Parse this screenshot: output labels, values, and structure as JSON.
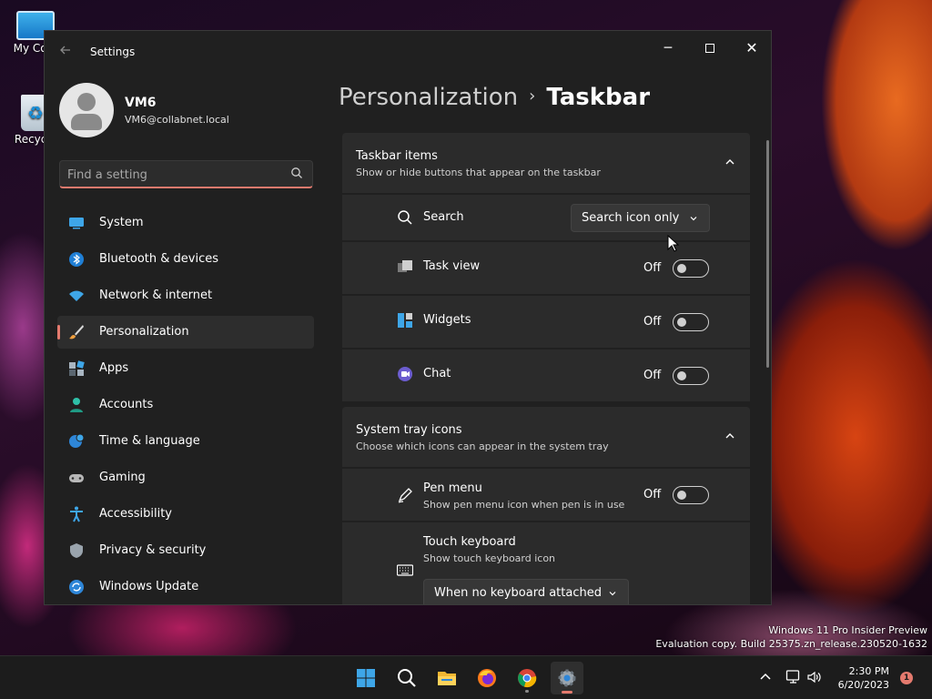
{
  "desktop": {
    "icons": [
      {
        "label": "My Com"
      },
      {
        "label": "Recycle"
      }
    ],
    "watermark": {
      "line1": "Windows 11 Pro Insider Preview",
      "line2": "Evaluation copy. Build 25375.zn_release.230520-1632"
    }
  },
  "window": {
    "title": "Settings",
    "controls": {
      "minimize": "─",
      "close": "✕"
    }
  },
  "profile": {
    "name": "VM6",
    "email": "VM6@collabnet.local"
  },
  "search": {
    "placeholder": "Find a setting"
  },
  "sidebar": {
    "items": [
      {
        "label": "System",
        "icon": "system-icon",
        "active": false
      },
      {
        "label": "Bluetooth & devices",
        "icon": "bluetooth-icon",
        "active": false
      },
      {
        "label": "Network & internet",
        "icon": "wifi-icon",
        "active": false
      },
      {
        "label": "Personalization",
        "icon": "brush-icon",
        "active": true
      },
      {
        "label": "Apps",
        "icon": "apps-icon",
        "active": false
      },
      {
        "label": "Accounts",
        "icon": "accounts-icon",
        "active": false
      },
      {
        "label": "Time & language",
        "icon": "globe-clock-icon",
        "active": false
      },
      {
        "label": "Gaming",
        "icon": "gamepad-icon",
        "active": false
      },
      {
        "label": "Accessibility",
        "icon": "accessibility-icon",
        "active": false
      },
      {
        "label": "Privacy & security",
        "icon": "shield-icon",
        "active": false
      },
      {
        "label": "Windows Update",
        "icon": "update-icon",
        "active": false
      }
    ]
  },
  "breadcrumb": {
    "parent": "Personalization",
    "separator": "›",
    "current": "Taskbar"
  },
  "taskbar_items": {
    "title": "Taskbar items",
    "subtitle": "Show or hide buttons that appear on the taskbar",
    "search": {
      "label": "Search",
      "value": "Search icon only"
    },
    "task_view": {
      "label": "Task view",
      "state": "Off"
    },
    "widgets": {
      "label": "Widgets",
      "state": "Off"
    },
    "chat": {
      "label": "Chat",
      "state": "Off"
    }
  },
  "system_tray": {
    "title": "System tray icons",
    "subtitle": "Choose which icons can appear in the system tray",
    "pen_menu": {
      "label": "Pen menu",
      "sublabel": "Show pen menu icon when pen is in use",
      "state": "Off"
    },
    "touch_keyboard": {
      "label": "Touch keyboard",
      "sublabel": "Show touch keyboard icon",
      "value": "When no keyboard attached"
    }
  },
  "taskbar": {
    "apps": [
      "start-icon",
      "search-icon",
      "file-explorer-icon",
      "firefox-icon",
      "chrome-icon",
      "settings-icon"
    ],
    "clock": {
      "time": "2:30 PM",
      "date": "6/20/2023"
    },
    "notifications": "1"
  },
  "colors": {
    "accent": "#e47a6e",
    "window_bg": "#202020",
    "card_bg": "#2b2b2b"
  }
}
